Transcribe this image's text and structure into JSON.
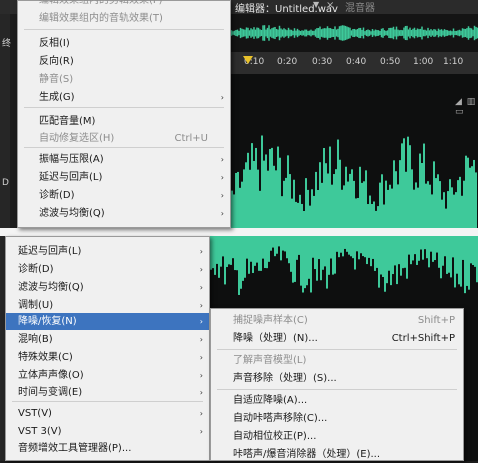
{
  "editor": {
    "tab_title": "编辑器：Untitled.wav",
    "tab_arrow": "▼",
    "tab_close": "×",
    "mixer_tab": "混音器",
    "side_label_1": "终",
    "side_label_2": "D",
    "meter_icons": "◢ ▥ ▭",
    "timeline_ticks": [
      "0:10",
      "0:20",
      "0:30",
      "0:40",
      "0:50",
      "1:00",
      "1:10"
    ],
    "waveform_color": "#3ec99a"
  },
  "menu_top": {
    "items": [
      {
        "label": "编辑效果组内的剪辑效果(F)",
        "disabled": true
      },
      {
        "label": "编辑效果组内的音轨效果(T)",
        "disabled": true
      },
      {
        "label": "反相(I)"
      },
      {
        "label": "反向(R)"
      },
      {
        "label": "静音(S)",
        "disabled": true
      },
      {
        "label": "生成(G)",
        "arrow": "›"
      },
      {
        "label": "匹配音量(M)"
      },
      {
        "label": "自动修复选区(H)",
        "disabled": true,
        "shortcut": "Ctrl+U"
      },
      {
        "label": "振幅与压限(A)",
        "arrow": "›"
      },
      {
        "label": "延迟与回声(L)",
        "arrow": "›"
      },
      {
        "label": "诊断(D)",
        "arrow": "›"
      },
      {
        "label": "滤波与均衡(Q)",
        "arrow": "›"
      }
    ]
  },
  "menu_left": {
    "items": [
      {
        "label": "延迟与回声(L)",
        "arrow": "›"
      },
      {
        "label": "诊断(D)",
        "arrow": "›"
      },
      {
        "label": "滤波与均衡(Q)",
        "arrow": "›"
      },
      {
        "label": "调制(U)",
        "arrow": "›"
      },
      {
        "label": "降噪/恢复(N)",
        "arrow": "›",
        "highlighted": true
      },
      {
        "label": "混响(B)",
        "arrow": "›"
      },
      {
        "label": "特殊效果(C)",
        "arrow": "›"
      },
      {
        "label": "立体声声像(O)",
        "arrow": "›"
      },
      {
        "label": "时间与变调(E)",
        "arrow": "›"
      },
      {
        "label": "VST(V)",
        "arrow": "›"
      },
      {
        "label": "VST 3(V)",
        "arrow": "›"
      },
      {
        "label": "音频增效工具管理器(P)..."
      }
    ]
  },
  "menu_sub": {
    "items": [
      {
        "label": "捕捉噪声样本(C)",
        "disabled": true,
        "shortcut": "Shift+P"
      },
      {
        "label": "降噪（处理）(N)...",
        "shortcut": "Ctrl+Shift+P"
      },
      {
        "label": "了解声音模型(L)",
        "disabled": true
      },
      {
        "label": "声音移除（处理）(S)..."
      },
      {
        "label": "自适应降噪(A)..."
      },
      {
        "label": "自动咔嗒声移除(C)..."
      },
      {
        "label": "自动相位校正(P)..."
      },
      {
        "label": "咔嗒声/爆音消除器（处理）(E)..."
      }
    ]
  }
}
